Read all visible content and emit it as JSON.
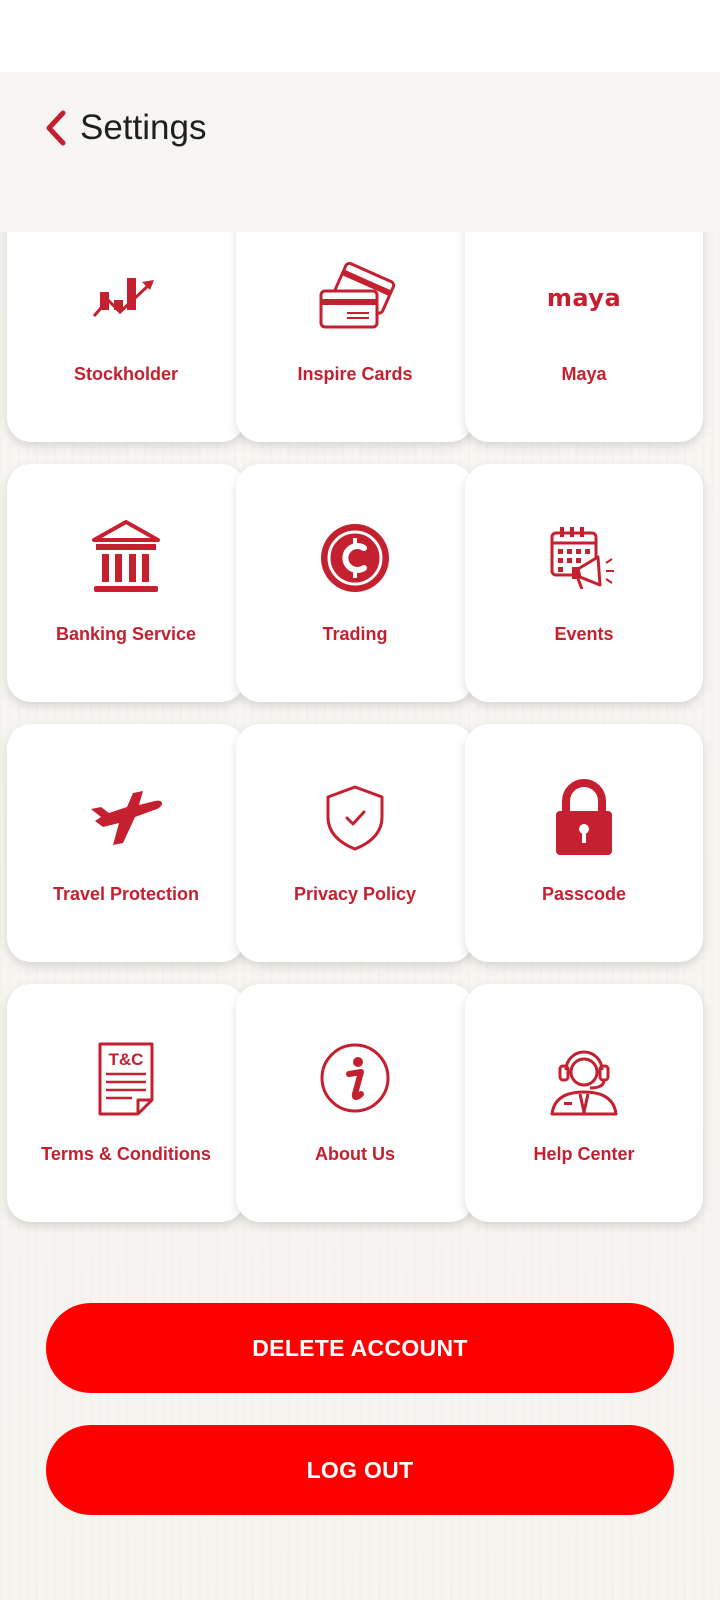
{
  "header": {
    "title": "Settings",
    "back_icon": "chevron-left-icon"
  },
  "colors": {
    "accent": "#c5202f",
    "button": "#ff0000",
    "background": "#f7f5f2"
  },
  "tiles": [
    {
      "label": "Stockholder",
      "icon": "stock-chart-icon"
    },
    {
      "label": "Inspire Cards",
      "icon": "credit-cards-icon"
    },
    {
      "label": "Maya",
      "icon": "maya-logo",
      "logo_text": "maya"
    },
    {
      "label": "Banking Service",
      "icon": "bank-icon"
    },
    {
      "label": "Trading",
      "icon": "crypto-coin-icon"
    },
    {
      "label": "Events",
      "icon": "calendar-megaphone-icon"
    },
    {
      "label": "Travel Protection",
      "icon": "airplane-icon"
    },
    {
      "label": "Privacy Policy",
      "icon": "shield-check-icon"
    },
    {
      "label": "Passcode",
      "icon": "padlock-icon"
    },
    {
      "label": "Terms & Conditions",
      "icon": "terms-document-icon",
      "icon_text": "T&C"
    },
    {
      "label": "About Us",
      "icon": "info-icon"
    },
    {
      "label": "Help Center",
      "icon": "headset-agent-icon"
    }
  ],
  "buttons": {
    "delete_account": "DELETE ACCOUNT",
    "log_out": "LOG OUT"
  }
}
